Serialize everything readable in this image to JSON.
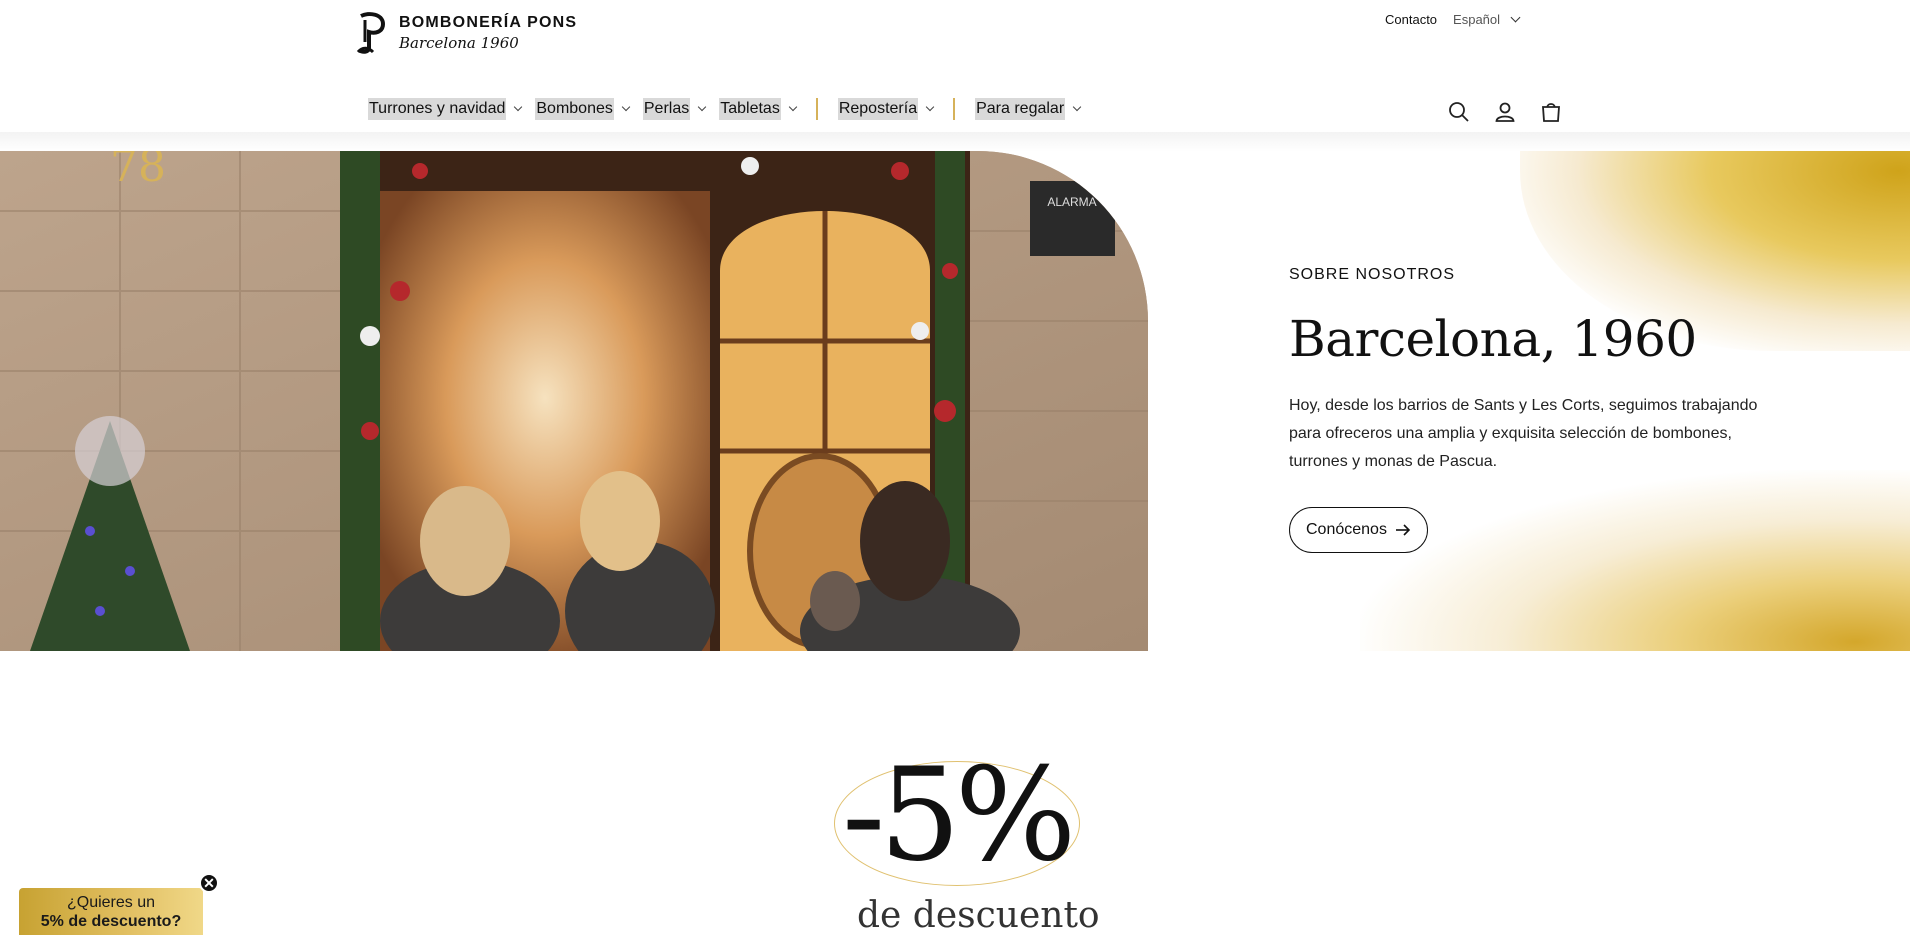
{
  "brand": {
    "name": "BOMBONERÍA PONS",
    "tagline": "Barcelona 1960"
  },
  "utility": {
    "contact": "Contacto",
    "language": "Español"
  },
  "nav": [
    {
      "label": "Turrones y navidad"
    },
    {
      "label": "Bombones"
    },
    {
      "label": "Perlas"
    },
    {
      "label": "Tabletas"
    },
    {
      "label": "Repostería"
    },
    {
      "label": "Para regalar"
    }
  ],
  "icons": [
    "search-icon",
    "account-icon",
    "cart-icon"
  ],
  "about": {
    "eyebrow": "SOBRE NOSOTROS",
    "title": "Barcelona, 1960",
    "body": "Hoy, desde los barrios de Sants y Les Corts, seguimos trabajando para ofreceros una amplia y exquisita selección de bombones, turrones y monas de Pascua.",
    "button": "Conócenos"
  },
  "discount": {
    "percent": "-5%",
    "label": "de descuento"
  },
  "popup": {
    "line1": "¿Quieres un",
    "line2": "5% de descuento?",
    "close": "✕"
  },
  "colors": {
    "gold": "#d6b25a",
    "text": "#121212"
  }
}
